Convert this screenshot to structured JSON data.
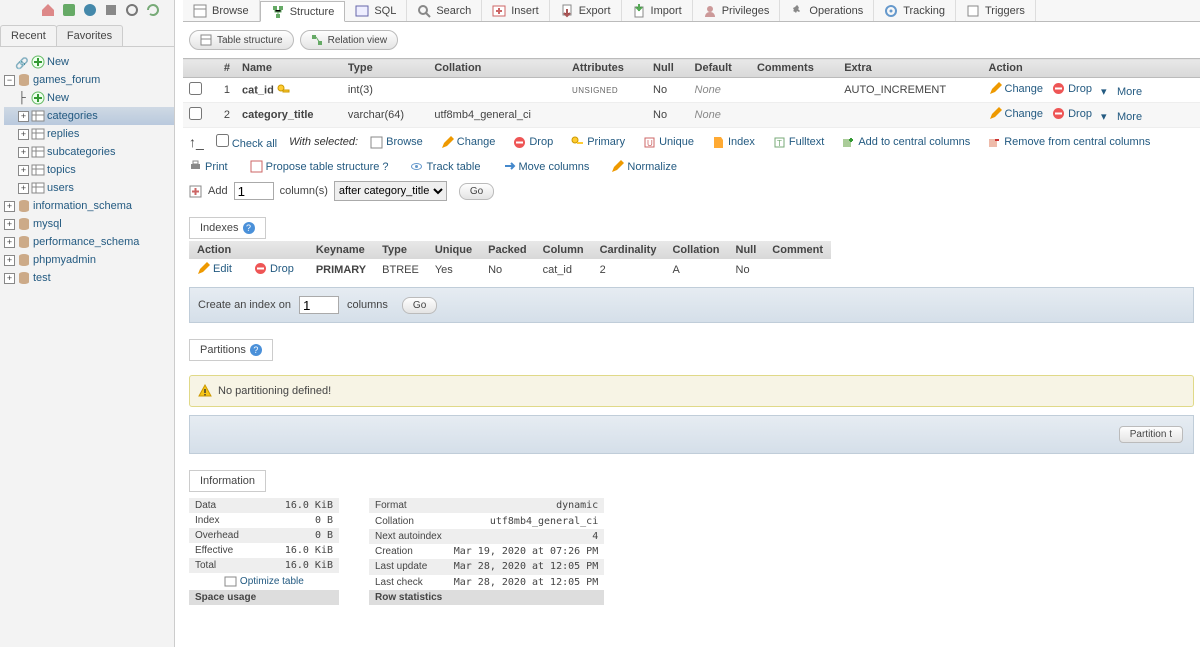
{
  "sidebar": {
    "tabs": {
      "recent": "Recent",
      "favorites": "Favorites"
    },
    "new_root": "New",
    "db": "games_forum",
    "new_table": "New",
    "tables": [
      "categories",
      "replies",
      "subcategories",
      "topics",
      "users"
    ],
    "other_dbs": [
      "information_schema",
      "mysql",
      "performance_schema",
      "phpmyadmin",
      "test"
    ]
  },
  "tabs": {
    "browse": "Browse",
    "structure": "Structure",
    "sql": "SQL",
    "search": "Search",
    "insert": "Insert",
    "export": "Export",
    "import": "Import",
    "privileges": "Privileges",
    "operations": "Operations",
    "tracking": "Tracking",
    "triggers": "Triggers"
  },
  "subtabs": {
    "table_structure": "Table structure",
    "relation_view": "Relation view"
  },
  "headers": {
    "num": "#",
    "name": "Name",
    "type": "Type",
    "collation": "Collation",
    "attributes": "Attributes",
    "null": "Null",
    "default": "Default",
    "comments": "Comments",
    "extra": "Extra",
    "action": "Action"
  },
  "cols": [
    {
      "num": "1",
      "name": "cat_id",
      "type": "int(3)",
      "collation": "",
      "attr": "UNSIGNED",
      "null": "No",
      "default": "None",
      "extra": "AUTO_INCREMENT",
      "pk": true
    },
    {
      "num": "2",
      "name": "category_title",
      "type": "varchar(64)",
      "collation": "utf8mb4_general_ci",
      "attr": "",
      "null": "No",
      "default": "None",
      "extra": "",
      "pk": false
    }
  ],
  "actions": {
    "change": "Change",
    "drop": "Drop",
    "more": "More"
  },
  "checkall": {
    "arrow_hint": "↳",
    "check_all": "Check all",
    "with_selected": "With selected:",
    "browse": "Browse",
    "change": "Change",
    "drop": "Drop",
    "primary": "Primary",
    "unique": "Unique",
    "index": "Index",
    "fulltext": "Fulltext",
    "add_central": "Add to central columns",
    "remove_central": "Remove from central columns"
  },
  "tools": {
    "print": "Print",
    "propose": "Propose table structure",
    "track": "Track table",
    "move_cols": "Move columns",
    "normalize": "Normalize"
  },
  "add": {
    "label": "Add",
    "value": "1",
    "unit": "column(s)",
    "position": "after category_title",
    "go": "Go"
  },
  "indexes": {
    "title": "Indexes",
    "h": {
      "action": "Action",
      "keyname": "Keyname",
      "type": "Type",
      "unique": "Unique",
      "packed": "Packed",
      "column": "Column",
      "cardinality": "Cardinality",
      "collation": "Collation",
      "null": "Null",
      "comment": "Comment"
    },
    "rows": [
      {
        "edit": "Edit",
        "drop": "Drop",
        "keyname": "PRIMARY",
        "type": "BTREE",
        "unique": "Yes",
        "packed": "No",
        "column": "cat_id",
        "cardinality": "2",
        "collation": "A",
        "null": "No",
        "comment": ""
      }
    ],
    "create_label_a": "Create an index on",
    "create_val": "1",
    "create_label_b": "columns",
    "go": "Go"
  },
  "partitions": {
    "title": "Partitions",
    "warn": "No partitioning defined!",
    "button": "Partition t"
  },
  "information": {
    "title": "Information",
    "space": {
      "data_l": "Data",
      "data_v": "16.0 KiB",
      "index_l": "Index",
      "index_v": "0 B",
      "overhead_l": "Overhead",
      "overhead_v": "0 B",
      "effective_l": "Effective",
      "effective_v": "16.0 KiB",
      "total_l": "Total",
      "total_v": "16.0 KiB",
      "optimize": "Optimize table",
      "header": "Space usage"
    },
    "row": {
      "format_l": "Format",
      "format_v": "dynamic",
      "collation_l": "Collation",
      "collation_v": "utf8mb4_general_ci",
      "next_l": "Next autoindex",
      "next_v": "4",
      "creation_l": "Creation",
      "creation_v": "Mar 19, 2020 at 07:26 PM",
      "last_upd_l": "Last update",
      "last_upd_v": "Mar 28, 2020 at 12:05 PM",
      "last_chk_l": "Last check",
      "last_chk_v": "Mar 28, 2020 at 12:05 PM",
      "header": "Row statistics"
    }
  }
}
